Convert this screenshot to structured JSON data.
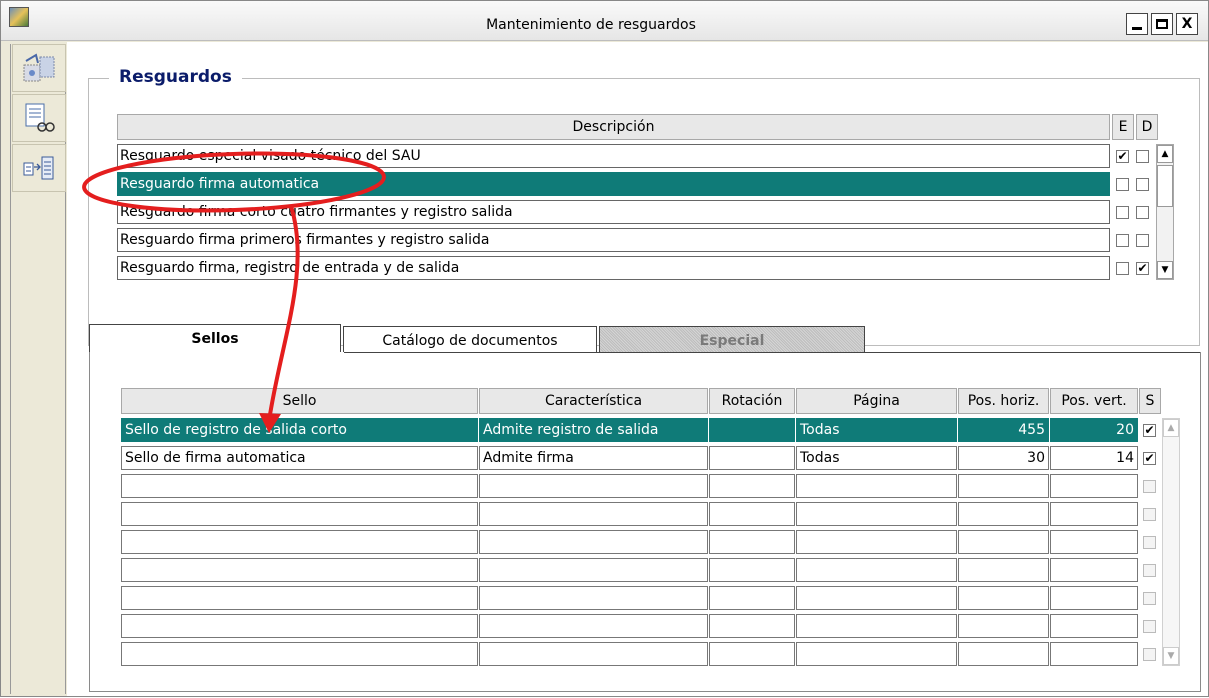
{
  "window": {
    "title": "Mantenimiento de resguardos",
    "buttons": {
      "minimize": "_",
      "maximize": "□",
      "close": "X"
    }
  },
  "toolbar": {
    "items": [
      {
        "icon": "wizard-icon"
      },
      {
        "icon": "document-view-icon"
      },
      {
        "icon": "transfer-list-icon"
      }
    ]
  },
  "resguardos": {
    "legend": "Resguardos",
    "headers": {
      "descripcion": "Descripción",
      "e": "E",
      "d": "D"
    },
    "rows": [
      {
        "descripcion": "Resguardo especial visado técnico del SAU",
        "e": true,
        "d": false
      },
      {
        "descripcion": "Resguardo firma automatica",
        "e": false,
        "d": false,
        "selected": true
      },
      {
        "descripcion": "Resguardo firma corto cuatro firmantes y registro salida",
        "e": false,
        "d": false
      },
      {
        "descripcion": "Resguardo firma primeros firmantes y registro salida",
        "e": false,
        "d": false
      },
      {
        "descripcion": "Resguardo firma, registro de entrada y de salida",
        "e": false,
        "d": true
      }
    ]
  },
  "tabs": [
    {
      "label": "Sellos",
      "active": true
    },
    {
      "label": "Catálogo de documentos",
      "active": false
    },
    {
      "label": "Especial",
      "active": false,
      "disabled": true
    }
  ],
  "sellos": {
    "headers": {
      "sello": "Sello",
      "caracteristica": "Característica",
      "rotacion": "Rotación",
      "pagina": "Página",
      "pos_horiz": "Pos. horiz.",
      "pos_vert": "Pos. vert.",
      "s": "S"
    },
    "rows": [
      {
        "sello": "Sello de registro de salida corto",
        "caracteristica": "Admite registro de salida",
        "rotacion": "",
        "pagina": "Todas",
        "pos_horiz": "455",
        "pos_vert": "20",
        "s": true,
        "selected": true
      },
      {
        "sello": "Sello de firma automatica",
        "caracteristica": "Admite firma",
        "rotacion": "",
        "pagina": "Todas",
        "pos_horiz": "30",
        "pos_vert": "14",
        "s": true
      },
      {
        "sello": "",
        "caracteristica": "",
        "rotacion": "",
        "pagina": "",
        "pos_horiz": "",
        "pos_vert": "",
        "s": false
      },
      {
        "sello": "",
        "caracteristica": "",
        "rotacion": "",
        "pagina": "",
        "pos_horiz": "",
        "pos_vert": "",
        "s": false
      },
      {
        "sello": "",
        "caracteristica": "",
        "rotacion": "",
        "pagina": "",
        "pos_horiz": "",
        "pos_vert": "",
        "s": false
      },
      {
        "sello": "",
        "caracteristica": "",
        "rotacion": "",
        "pagina": "",
        "pos_horiz": "",
        "pos_vert": "",
        "s": false
      },
      {
        "sello": "",
        "caracteristica": "",
        "rotacion": "",
        "pagina": "",
        "pos_horiz": "",
        "pos_vert": "",
        "s": false
      },
      {
        "sello": "",
        "caracteristica": "",
        "rotacion": "",
        "pagina": "",
        "pos_horiz": "",
        "pos_vert": "",
        "s": false
      }
    ]
  },
  "colors": {
    "selection": "#0f7b78",
    "legend": "#0b1c6a",
    "annotation": "#e41e1e"
  }
}
